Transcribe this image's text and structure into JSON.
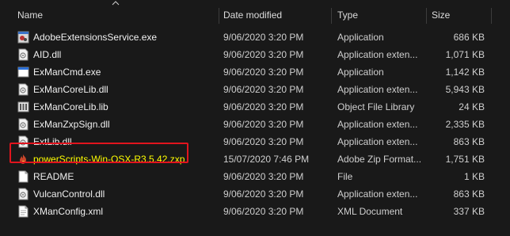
{
  "columns": {
    "name": "Name",
    "date": "Date modified",
    "type": "Type",
    "size": "Size"
  },
  "files": [
    {
      "name": "AdobeExtensionsService.exe",
      "date": "9/06/2020 3:20 PM",
      "type": "Application",
      "size": "686 KB",
      "icon": "exe-app-icon"
    },
    {
      "name": "AID.dll",
      "date": "9/06/2020 3:20 PM",
      "type": "Application exten...",
      "size": "1,071 KB",
      "icon": "dll-icon"
    },
    {
      "name": "ExManCmd.exe",
      "date": "9/06/2020 3:20 PM",
      "type": "Application",
      "size": "1,142 KB",
      "icon": "exe-window-icon"
    },
    {
      "name": "ExManCoreLib.dll",
      "date": "9/06/2020 3:20 PM",
      "type": "Application exten...",
      "size": "5,943 KB",
      "icon": "dll-icon"
    },
    {
      "name": "ExManCoreLib.lib",
      "date": "9/06/2020 3:20 PM",
      "type": "Object File Library",
      "size": "24 KB",
      "icon": "lib-icon"
    },
    {
      "name": "ExManZxpSign.dll",
      "date": "9/06/2020 3:20 PM",
      "type": "Application exten...",
      "size": "2,335 KB",
      "icon": "dll-icon"
    },
    {
      "name": "ExtLib.dll",
      "date": "9/06/2020 3:20 PM",
      "type": "Application exten...",
      "size": "863 KB",
      "icon": "dll-icon"
    },
    {
      "name": "powerScripts-Win-OSX-R3.5.42.zxp",
      "date": "15/07/2020 7:46 PM",
      "type": "Adobe Zip Format...",
      "size": "1,751 KB",
      "icon": "zxp-icon"
    },
    {
      "name": "README",
      "date": "9/06/2020 3:20 PM",
      "type": "File",
      "size": "1 KB",
      "icon": "blank-file-icon"
    },
    {
      "name": "VulcanControl.dll",
      "date": "9/06/2020 3:20 PM",
      "type": "Application exten...",
      "size": "863 KB",
      "icon": "dll-icon"
    },
    {
      "name": "XManConfig.xml",
      "date": "9/06/2020 3:20 PM",
      "type": "XML Document",
      "size": "337 KB",
      "icon": "xml-file-icon"
    }
  ],
  "highlighted_index": 7,
  "colors": {
    "background": "#191919",
    "highlight_border": "#e1141e",
    "highlight_text": "#ffff00"
  }
}
